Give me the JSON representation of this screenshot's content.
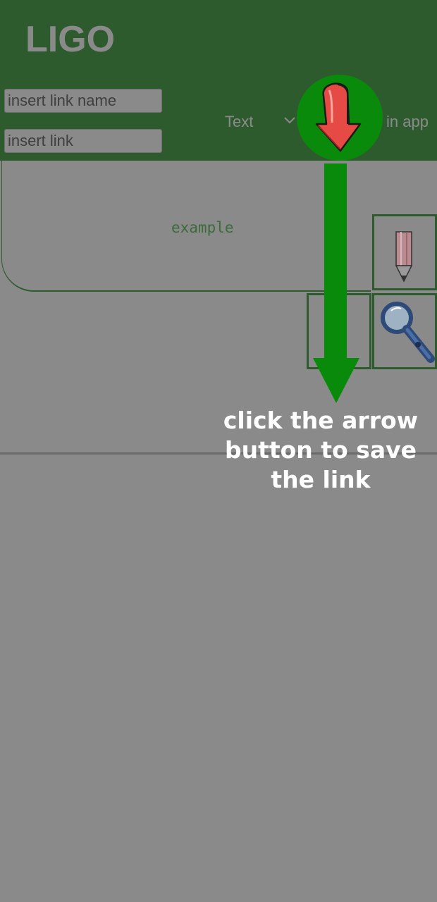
{
  "app": {
    "title": "LIGO"
  },
  "form": {
    "link_name_placeholder": "insert link name",
    "link_placeholder": "insert link",
    "type_selected": "Text",
    "in_app_label": "in app"
  },
  "icons": {
    "save": "red-down-arrow-icon",
    "edit": "pencil-icon",
    "search": "magnifier-icon",
    "dropdown": "chevron-down-icon"
  },
  "list": {
    "items": [
      {
        "label": "example"
      }
    ]
  },
  "tutorial": {
    "hint": "click the arrow button to save the link"
  },
  "colors": {
    "header": "#2e5b2e",
    "accent_green": "#0a8a0a",
    "overlay_gray": "#8a8a8a",
    "arrow_red": "#e64a45"
  }
}
